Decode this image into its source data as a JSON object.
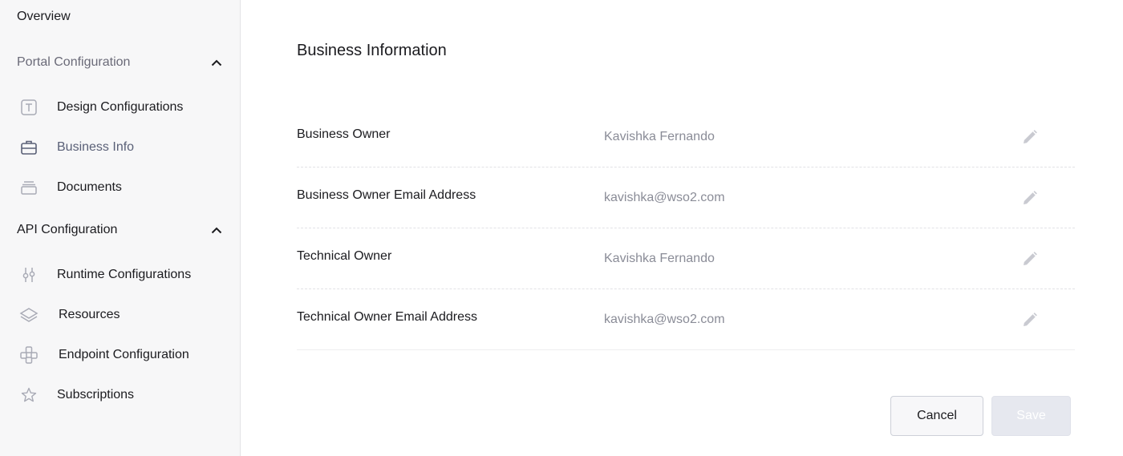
{
  "sidebar": {
    "overview": "Overview",
    "portal_section": {
      "label": "Portal Configuration",
      "icon": "chevron-up-icon"
    },
    "portal_items": [
      {
        "label": "Design Configurations",
        "icon": "text-box-icon"
      },
      {
        "label": "Business Info",
        "icon": "briefcase-icon",
        "active": true
      },
      {
        "label": "Documents",
        "icon": "stack-icon"
      }
    ],
    "api_section": {
      "label": "API Configuration",
      "icon": "chevron-up-icon"
    },
    "api_items": [
      {
        "label": "Runtime Configurations",
        "icon": "sliders-icon"
      },
      {
        "label": "Resources",
        "icon": "layers-icon"
      },
      {
        "label": "Endpoint Configuration",
        "icon": "endpoint-icon"
      },
      {
        "label": "Subscriptions",
        "icon": "star-icon"
      }
    ]
  },
  "main": {
    "title": "Business Information",
    "rows": [
      {
        "label": "Business Owner",
        "value": "Kavishka Fernando"
      },
      {
        "label": "Business Owner Email Address",
        "value": "kavishka@wso2.com"
      },
      {
        "label": "Technical Owner",
        "value": "Kavishka Fernando"
      },
      {
        "label": "Technical Owner Email Address",
        "value": "kavishka@wso2.com"
      }
    ],
    "cancel_label": "Cancel",
    "save_label": "Save"
  },
  "colors": {
    "sidebar_bg": "#f7f7f8",
    "muted_text": "#8a8c97",
    "save_disabled_bg": "#e6e8ef"
  }
}
